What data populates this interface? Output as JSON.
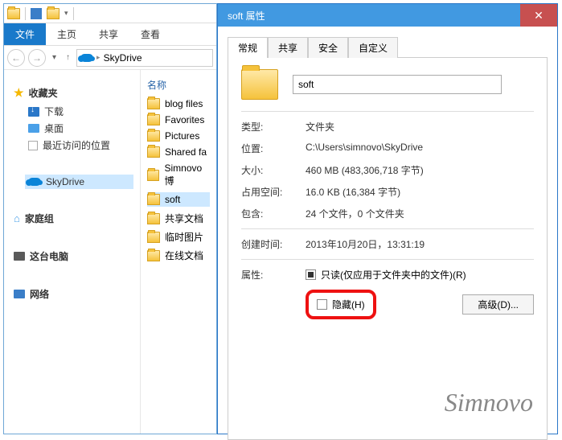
{
  "explorer": {
    "ribbon": {
      "file": "文件",
      "tabs": [
        "主页",
        "共享",
        "查看"
      ]
    },
    "address": "SkyDrive",
    "navpane": {
      "fav_head": "收藏夹",
      "fav_items": [
        "下载",
        "桌面",
        "最近访问的位置"
      ],
      "skydrive": "SkyDrive",
      "homegroup": "家庭组",
      "thispc": "这台电脑",
      "network": "网络"
    },
    "column_header": "名称",
    "files": [
      "blog files",
      "Favorites",
      "Pictures",
      "Shared fa",
      "Simnovo博",
      "soft",
      "共享文档",
      "临时图片",
      "在线文档"
    ]
  },
  "props": {
    "title": "soft 属性",
    "tabs": [
      "常规",
      "共享",
      "安全",
      "自定义"
    ],
    "folder_name": "soft",
    "rows": {
      "type_l": "类型:",
      "type_v": "文件夹",
      "loc_l": "位置:",
      "loc_v": "C:\\Users\\simnovo\\SkyDrive",
      "size_l": "大小:",
      "size_v": "460 MB (483,306,718 字节)",
      "disk_l": "占用空间:",
      "disk_v": "16.0 KB (16,384 字节)",
      "contains_l": "包含:",
      "contains_v": "24 个文件，0 个文件夹",
      "created_l": "创建时间:",
      "created_v": "2013年10月20日，13:31:19",
      "attr_l": "属性:",
      "readonly": "只读(仅应用于文件夹中的文件)(R)",
      "hidden": "隐藏(H)",
      "advanced": "高级(D)..."
    }
  },
  "watermark": "Simnovo"
}
